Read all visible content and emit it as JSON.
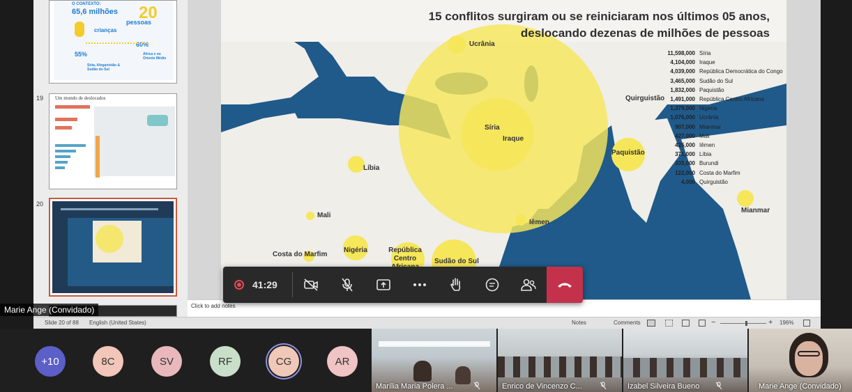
{
  "slide_panel": {
    "thumbnails": [
      {
        "number": "",
        "caption": ""
      },
      {
        "number": "19",
        "caption": "Um mundo de deslocados"
      },
      {
        "number": "20",
        "caption": ""
      },
      {
        "number": "",
        "caption": ""
      }
    ],
    "thumb18_texts": [
      "O CONTEXTO:",
      "65,6 milhões",
      "20",
      "pessoas",
      "crianças",
      "55%",
      "60%",
      "Síria, Afeganistão & Sudão do Sul",
      "África e no Oriente Médio"
    ]
  },
  "slide": {
    "title_line1": "15 conflitos surgiram ou se reiniciaram nos últimos 05 anos,",
    "title_line2": "deslocando dezenas de milhões de pessoas",
    "map_labels": [
      "Ucrânia",
      "Síria",
      "Iraque",
      "Quirguistão",
      "Paquistão",
      "Líbia",
      "Mali",
      "Iêmen",
      "Mianmar",
      "Costa do Marfim",
      "Nigéria",
      "República Centro Africana",
      "Sudão do Sul"
    ],
    "stats": [
      {
        "value": "11,598,000",
        "country": "Síria"
      },
      {
        "value": "4,104,000",
        "country": "Iraque"
      },
      {
        "value": "4,039,000",
        "country": "República Democrática do Congo"
      },
      {
        "value": "3,465,000",
        "country": "Sudão do Sul"
      },
      {
        "value": "1,832,000",
        "country": "Paquistão"
      },
      {
        "value": "1,491,000",
        "country": "República Centro Africana"
      },
      {
        "value": "1,379,000",
        "country": "Nigéria"
      },
      {
        "value": "1,076,000",
        "country": "Ucrânia"
      },
      {
        "value": "907,000",
        "country": "Mianmar"
      },
      {
        "value": "427,000",
        "country": "Mali"
      },
      {
        "value": "425,000",
        "country": "Iêmen"
      },
      {
        "value": "371,000",
        "country": "Líbia"
      },
      {
        "value": "335,000",
        "country": "Burundi"
      },
      {
        "value": "122,000",
        "country": "Costa do Marfim"
      },
      {
        "value": "4,000",
        "country": "Quirguistão"
      }
    ],
    "colors": {
      "ocean": "#1f5a8a",
      "land": "#efeee9",
      "bubble": "#f6e65a"
    }
  },
  "notes_placeholder": "Click to add notes",
  "status": {
    "slide_of": "Slide 20 of 88",
    "language": "English (United States)",
    "notes": "Notes",
    "comments": "Comments",
    "zoom": "196%"
  },
  "presenter_label": "Marie Ange (Convidado)",
  "toolbar": {
    "timer": "41:29",
    "icons": [
      "record-icon",
      "camera-off-icon",
      "mic-off-icon",
      "share-icon",
      "more-icon",
      "raise-hand-icon",
      "chat-icon",
      "people-icon",
      "hang-up-icon"
    ],
    "colors": {
      "hangup": "#c4314b",
      "record": "#e74856"
    }
  },
  "participants": {
    "more_count": "+10",
    "avatars": [
      {
        "initials": "8C",
        "color": "#f2c6b8"
      },
      {
        "initials": "SV",
        "color": "#e8b8bd"
      },
      {
        "initials": "RF",
        "color": "#c9dfc9"
      },
      {
        "initials": "CG",
        "color": "#f0c8b8"
      },
      {
        "initials": "AR",
        "color": "#f0c4c4"
      }
    ],
    "videos": [
      {
        "name": "Marília Maria Polera ..."
      },
      {
        "name": "Enrico de Vincenzo C..."
      },
      {
        "name": "Izabel Silveira Bueno"
      },
      {
        "name": "Marie Ange (Convidado)"
      }
    ],
    "more_color": "#5b5fc7"
  }
}
